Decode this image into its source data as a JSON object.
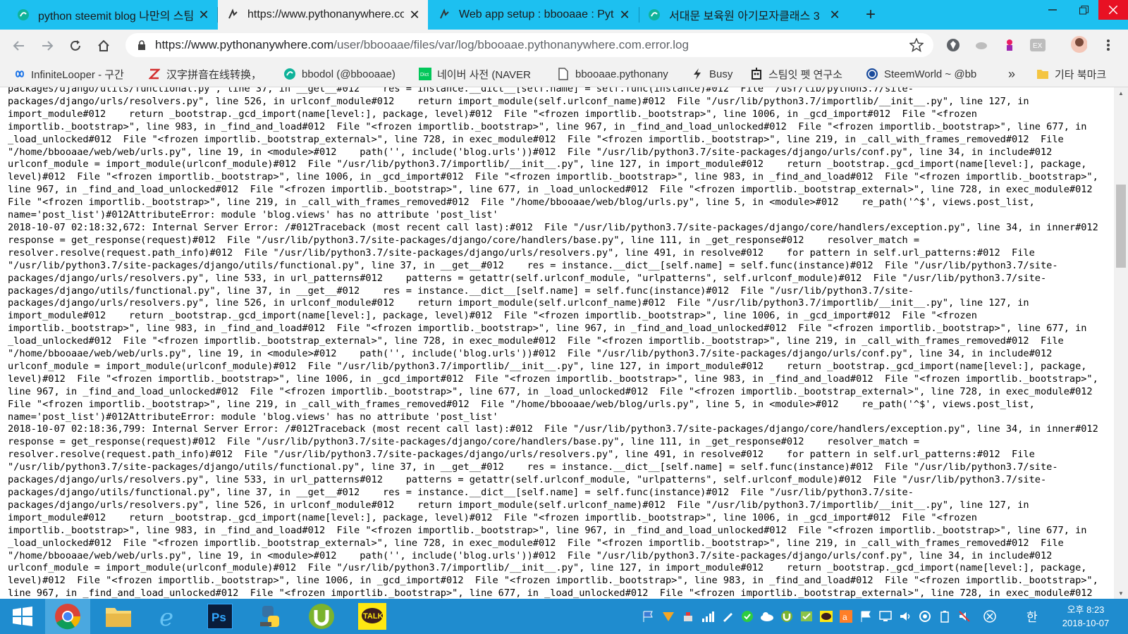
{
  "tabs": [
    {
      "title": "python steemit blog 나만의 스팀",
      "icon": "steem-icon"
    },
    {
      "title": "https://www.pythonanywhere.com",
      "icon": "pythonanywhere-icon"
    },
    {
      "title": "Web app setup : bbooaae : Pyth",
      "icon": "pythonanywhere-icon"
    },
    {
      "title": "서대문 보육원 아기모자클래스 3",
      "icon": "steem-icon"
    }
  ],
  "address_bar": {
    "host": "https://www.pythonanywhere.com",
    "path": "/user/bbooaae/files/var/log/bbooaae.pythonanywhere.com.error.log"
  },
  "bookmarks": [
    {
      "label": "InfiniteLooper - 구간",
      "icon": "infinity-icon"
    },
    {
      "label": "汉字拼音在线转换，",
      "icon": "z-icon"
    },
    {
      "label": "bbodol (@bbooaae)",
      "icon": "steem-icon"
    },
    {
      "label": "네이버 사전 (NAVER",
      "icon": "dict-icon"
    },
    {
      "label": "bbooaae.pythonany",
      "icon": "page-icon"
    },
    {
      "label": "Busy",
      "icon": "lightning-icon"
    },
    {
      "label": "스팀잇 펫 연구소",
      "icon": "robot-icon"
    },
    {
      "label": "SteemWorld ~ @bb",
      "icon": "wordpress-icon"
    },
    {
      "label": "»",
      "icon": ""
    },
    {
      "label": "기타 북마크",
      "icon": "folder-icon"
    }
  ],
  "log_lines": [
    "packages/django/utils/functional.py\", line 37, in __get__#012    res = instance.__dict__[self.name] = self.func(instance)#012  File \"/usr/lib/python3.7/site-",
    "packages/django/urls/resolvers.py\", line 526, in urlconf_module#012    return import_module(self.urlconf_name)#012  File \"/usr/lib/python3.7/importlib/__init__.py\", line 127, in",
    "import_module#012    return _bootstrap._gcd_import(name[level:], package, level)#012  File \"<frozen importlib._bootstrap>\", line 1006, in _gcd_import#012  File \"<frozen",
    "importlib._bootstrap>\", line 983, in _find_and_load#012  File \"<frozen importlib._bootstrap>\", line 967, in _find_and_load_unlocked#012  File \"<frozen importlib._bootstrap>\", line 677, in",
    "_load_unlocked#012  File \"<frozen importlib._bootstrap_external>\", line 728, in exec_module#012  File \"<frozen importlib._bootstrap>\", line 219, in _call_with_frames_removed#012  File",
    "\"/home/bbooaae/web/web/urls.py\", line 19, in <module>#012    path('', include('blog.urls'))#012  File \"/usr/lib/python3.7/site-packages/django/urls/conf.py\", line 34, in include#012",
    "urlconf_module = import_module(urlconf_module)#012  File \"/usr/lib/python3.7/importlib/__init__.py\", line 127, in import_module#012    return _bootstrap._gcd_import(name[level:], package,",
    "level)#012  File \"<frozen importlib._bootstrap>\", line 1006, in _gcd_import#012  File \"<frozen importlib._bootstrap>\", line 983, in _find_and_load#012  File \"<frozen importlib._bootstrap>\",",
    "line 967, in _find_and_load_unlocked#012  File \"<frozen importlib._bootstrap>\", line 677, in _load_unlocked#012  File \"<frozen importlib._bootstrap_external>\", line 728, in exec_module#012",
    "File \"<frozen importlib._bootstrap>\", line 219, in _call_with_frames_removed#012  File \"/home/bbooaae/web/blog/urls.py\", line 5, in <module>#012    re_path('^$', views.post_list,",
    "name='post_list')#012AttributeError: module 'blog.views' has no attribute 'post_list'",
    "2018-10-07 02:18:32,672: Internal Server Error: /#012Traceback (most recent call last):#012  File \"/usr/lib/python3.7/site-packages/django/core/handlers/exception.py\", line 34, in inner#012",
    "response = get_response(request)#012  File \"/usr/lib/python3.7/site-packages/django/core/handlers/base.py\", line 111, in _get_response#012    resolver_match =",
    "resolver.resolve(request.path_info)#012  File \"/usr/lib/python3.7/site-packages/django/urls/resolvers.py\", line 491, in resolve#012    for pattern in self.url_patterns:#012  File",
    "\"/usr/lib/python3.7/site-packages/django/utils/functional.py\", line 37, in __get__#012    res = instance.__dict__[self.name] = self.func(instance)#012  File \"/usr/lib/python3.7/site-",
    "packages/django/urls/resolvers.py\", line 533, in url_patterns#012    patterns = getattr(self.urlconf_module, \"urlpatterns\", self.urlconf_module)#012  File \"/usr/lib/python3.7/site-",
    "packages/django/utils/functional.py\", line 37, in __get__#012    res = instance.__dict__[self.name] = self.func(instance)#012  File \"/usr/lib/python3.7/site-",
    "packages/django/urls/resolvers.py\", line 526, in urlconf_module#012    return import_module(self.urlconf_name)#012  File \"/usr/lib/python3.7/importlib/__init__.py\", line 127, in",
    "import_module#012    return _bootstrap._gcd_import(name[level:], package, level)#012  File \"<frozen importlib._bootstrap>\", line 1006, in _gcd_import#012  File \"<frozen",
    "importlib._bootstrap>\", line 983, in _find_and_load#012  File \"<frozen importlib._bootstrap>\", line 967, in _find_and_load_unlocked#012  File \"<frozen importlib._bootstrap>\", line 677, in",
    "_load_unlocked#012  File \"<frozen importlib._bootstrap_external>\", line 728, in exec_module#012  File \"<frozen importlib._bootstrap>\", line 219, in _call_with_frames_removed#012  File",
    "\"/home/bbooaae/web/web/urls.py\", line 19, in <module>#012    path('', include('blog.urls'))#012  File \"/usr/lib/python3.7/site-packages/django/urls/conf.py\", line 34, in include#012",
    "urlconf_module = import_module(urlconf_module)#012  File \"/usr/lib/python3.7/importlib/__init__.py\", line 127, in import_module#012    return _bootstrap._gcd_import(name[level:], package,",
    "level)#012  File \"<frozen importlib._bootstrap>\", line 1006, in _gcd_import#012  File \"<frozen importlib._bootstrap>\", line 983, in _find_and_load#012  File \"<frozen importlib._bootstrap>\",",
    "line 967, in _find_and_load_unlocked#012  File \"<frozen importlib._bootstrap>\", line 677, in _load_unlocked#012  File \"<frozen importlib._bootstrap_external>\", line 728, in exec_module#012",
    "File \"<frozen importlib._bootstrap>\", line 219, in _call_with_frames_removed#012  File \"/home/bbooaae/web/blog/urls.py\", line 5, in <module>#012    re_path('^$', views.post_list,",
    "name='post_list')#012AttributeError: module 'blog.views' has no attribute 'post_list'",
    "2018-10-07 02:18:36,799: Internal Server Error: /#012Traceback (most recent call last):#012  File \"/usr/lib/python3.7/site-packages/django/core/handlers/exception.py\", line 34, in inner#012",
    "response = get_response(request)#012  File \"/usr/lib/python3.7/site-packages/django/core/handlers/base.py\", line 111, in _get_response#012    resolver_match =",
    "resolver.resolve(request.path_info)#012  File \"/usr/lib/python3.7/site-packages/django/urls/resolvers.py\", line 491, in resolve#012    for pattern in self.url_patterns:#012  File",
    "\"/usr/lib/python3.7/site-packages/django/utils/functional.py\", line 37, in __get__#012    res = instance.__dict__[self.name] = self.func(instance)#012  File \"/usr/lib/python3.7/site-",
    "packages/django/urls/resolvers.py\", line 533, in url_patterns#012    patterns = getattr(self.urlconf_module, \"urlpatterns\", self.urlconf_module)#012  File \"/usr/lib/python3.7/site-",
    "packages/django/utils/functional.py\", line 37, in __get__#012    res = instance.__dict__[self.name] = self.func(instance)#012  File \"/usr/lib/python3.7/site-",
    "packages/django/urls/resolvers.py\", line 526, in urlconf_module#012    return import_module(self.urlconf_name)#012  File \"/usr/lib/python3.7/importlib/__init__.py\", line 127, in",
    "import_module#012    return _bootstrap._gcd_import(name[level:], package, level)#012  File \"<frozen importlib._bootstrap>\", line 1006, in _gcd_import#012  File \"<frozen",
    "importlib._bootstrap>\", line 983, in _find_and_load#012  File \"<frozen importlib._bootstrap>\", line 967, in _find_and_load_unlocked#012  File \"<frozen importlib._bootstrap>\", line 677, in",
    "_load_unlocked#012  File \"<frozen importlib._bootstrap_external>\", line 728, in exec_module#012  File \"<frozen importlib._bootstrap>\", line 219, in _call_with_frames_removed#012  File",
    "\"/home/bbooaae/web/web/urls.py\", line 19, in <module>#012    path('', include('blog.urls'))#012  File \"/usr/lib/python3.7/site-packages/django/urls/conf.py\", line 34, in include#012",
    "urlconf_module = import_module(urlconf_module)#012  File \"/usr/lib/python3.7/importlib/__init__.py\", line 127, in import_module#012    return _bootstrap._gcd_import(name[level:], package,",
    "level)#012  File \"<frozen importlib._bootstrap>\", line 1006, in _gcd_import#012  File \"<frozen importlib._bootstrap>\", line 983, in _find_and_load#012  File \"<frozen importlib._bootstrap>\",",
    "line 967, in _find_and_load_unlocked#012  File \"<frozen importlib._bootstrap>\", line 677, in _load_unlocked#012  File \"<frozen importlib._bootstrap_external>\", line 728, in exec_module#012"
  ],
  "taskbar": {
    "apps": [
      "start-icon",
      "chrome-icon",
      "file-explorer-icon",
      "internet-explorer-icon",
      "photoshop-icon",
      "python-icon",
      "utorrent-icon",
      "kakaotalk-icon"
    ],
    "photoshop_label": "Ps",
    "kakaotalk_label": "TALK",
    "ime_label": "한",
    "clock_time": "오후 8:23",
    "clock_date": "2018-10-07"
  },
  "colors": {
    "tab_strip": "#1dc0f0",
    "taskbar": "#1f8ccf",
    "close_button": "#e81123"
  }
}
